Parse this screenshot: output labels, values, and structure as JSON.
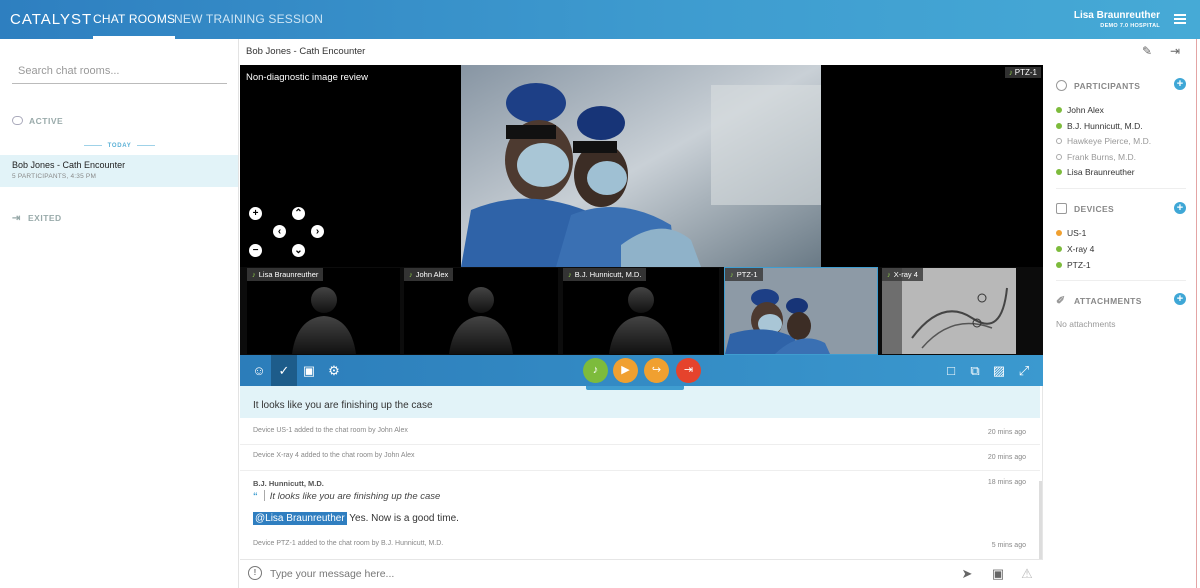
{
  "header": {
    "logo": "CATALYST",
    "nav_active": "CHAT ROOMS",
    "nav_inactive": "NEW TRAINING SESSION",
    "user_name": "Lisa Braunreuther",
    "hospital": "DEMO 7.0 HOSPITAL"
  },
  "left": {
    "search_placeholder": "Search chat rooms...",
    "active_label": "ACTIVE",
    "today_label": "TODAY",
    "room_title": "Bob Jones - Cath Encounter",
    "room_sub": "5 PARTICIPANTS, 4:35 PM",
    "exited_label": "EXITED"
  },
  "center": {
    "title": "Bob Jones - Cath Encounter",
    "video_title": "Non-diagnostic image review",
    "video_tag": "PTZ-1",
    "thumbs": [
      {
        "label": "Lisa Braunreuther"
      },
      {
        "label": "John Alex"
      },
      {
        "label": "B.J. Hunnicutt, M.D."
      },
      {
        "label": "PTZ-1"
      },
      {
        "label": "X-ray 4"
      }
    ]
  },
  "feed": {
    "highlight_msg": "It looks like you are finishing up the case",
    "sys1": "Device US-1 added to the chat room by John Alex",
    "sys1_time": "20 mins ago",
    "sys2": "Device X-ray 4 added to the chat room by John Alex",
    "sys2_time": "20 mins ago",
    "sender": "B.J. Hunnicutt, M.D.",
    "sender_time": "18 mins ago",
    "quote": "It looks like you are finishing up the case",
    "mention": "@Lisa Braunreuther",
    "reply": " Yes. Now is a good time.",
    "sys3": "Device PTZ-1 added to the chat room by B.J. Hunnicutt, M.D.",
    "sys3_time": "5 mins ago"
  },
  "input": {
    "placeholder": "Type your message here..."
  },
  "right": {
    "participants_label": "PARTICIPANTS",
    "participants": [
      {
        "name": "John Alex",
        "status": "online"
      },
      {
        "name": "B.J. Hunnicutt, M.D.",
        "status": "online"
      },
      {
        "name": "Hawkeye Pierce, M.D.",
        "status": "offline"
      },
      {
        "name": "Frank Burns, M.D.",
        "status": "offline"
      },
      {
        "name": "Lisa Braunreuther",
        "status": "online"
      }
    ],
    "devices_label": "DEVICES",
    "devices": [
      {
        "name": "US-1",
        "color": "#f0a030"
      },
      {
        "name": "X-ray 4",
        "color": "#7dbb3c"
      },
      {
        "name": "PTZ-1",
        "color": "#7dbb3c"
      }
    ],
    "attachments_label": "ATTACHMENTS",
    "no_attachments": "No attachments"
  },
  "colors": {
    "brand": "#3f9dd0",
    "online": "#7dbb3c",
    "mic": "#7dbb3c",
    "video": "#f0a030",
    "share": "#f0a030",
    "leave": "#e5432c"
  }
}
